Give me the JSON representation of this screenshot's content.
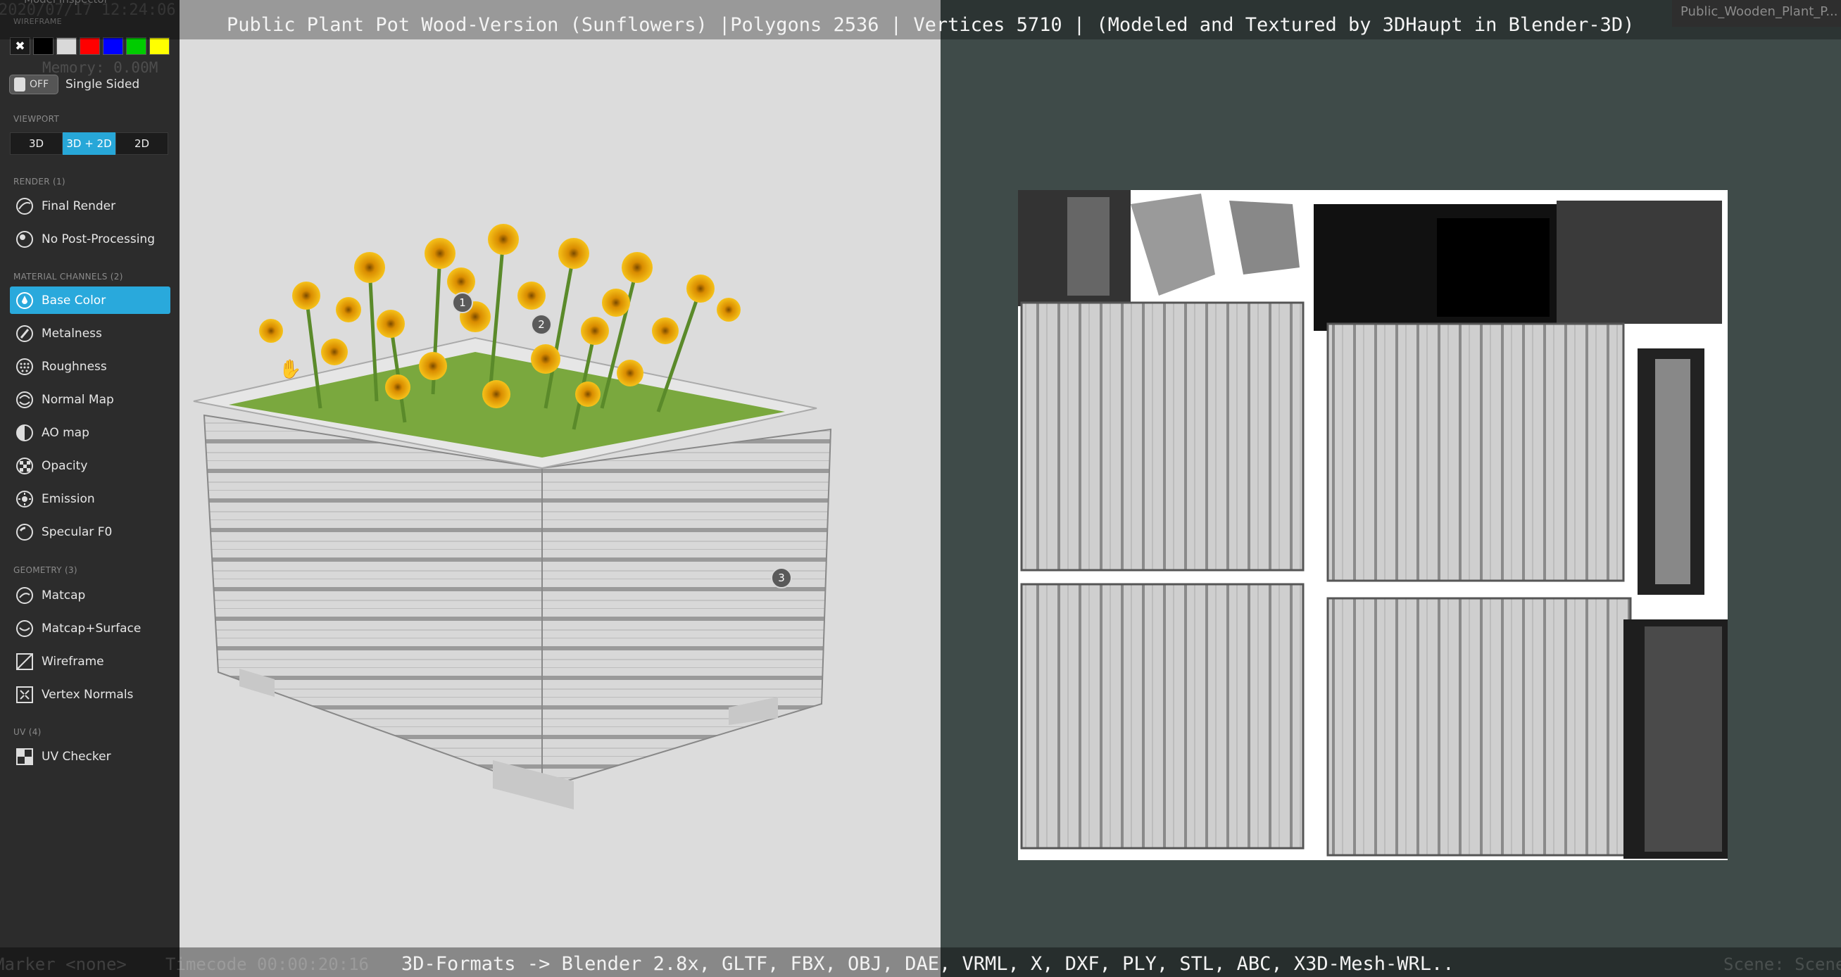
{
  "title_bar": {
    "text": "Public Plant Pot Wood-Version (Sunflowers) |Polygons 2536 | Vertices 5710 | (Modeled and Textured by 3DHaupt in Blender-3D)"
  },
  "file_tab": {
    "label": "Public_Wooden_Plant_P..."
  },
  "bottom_bar": {
    "text": "3D-Formats -> Blender 2.8x, GLTF, FBX, OBJ, DAE, VRML, X, DXF, PLY, STL, ABC, X3D-Mesh-WRL.."
  },
  "hud": {
    "timestamp": "2020/07/17 12:24:06",
    "memory": "Memory: 0.00M",
    "marker": "Marker <none>",
    "timecode": "Timecode 00:00:20:16",
    "scene": "Scene: Scene"
  },
  "sidebar": {
    "title": "Model Inspector",
    "wireframe_label": "WIREFRAME",
    "swatch_colors": [
      "#1a1a1a",
      "#000000",
      "#d9d9d9",
      "#ff0000",
      "#0000ff",
      "#00cc00",
      "#ffff00"
    ],
    "single_sided": {
      "state": "OFF",
      "label": "Single Sided"
    },
    "viewport": {
      "label": "VIEWPORT",
      "options": [
        "3D",
        "3D + 2D",
        "2D"
      ],
      "selected": "3D + 2D"
    },
    "render": {
      "label": "RENDER (1)",
      "items": [
        "Final Render",
        "No Post-Processing"
      ]
    },
    "material_channels": {
      "label": "MATERIAL CHANNELS (2)",
      "items": [
        "Base Color",
        "Metalness",
        "Roughness",
        "Normal Map",
        "AO map",
        "Opacity",
        "Emission",
        "Specular F0"
      ],
      "selected": "Base Color"
    },
    "geometry": {
      "label": "GEOMETRY (3)",
      "items": [
        "Matcap",
        "Matcap+Surface",
        "Wireframe",
        "Vertex Normals"
      ]
    },
    "uv": {
      "label": "UV (4)",
      "items": [
        "UV Checker"
      ]
    }
  },
  "annotations": [
    "1",
    "2",
    "3"
  ],
  "colors": {
    "accent": "#29a9dc",
    "sidebar_bg": "#2c2c2c",
    "viewport_3d_bg": "#dcdcdc",
    "viewport_2d_bg": "#3f4b49"
  }
}
